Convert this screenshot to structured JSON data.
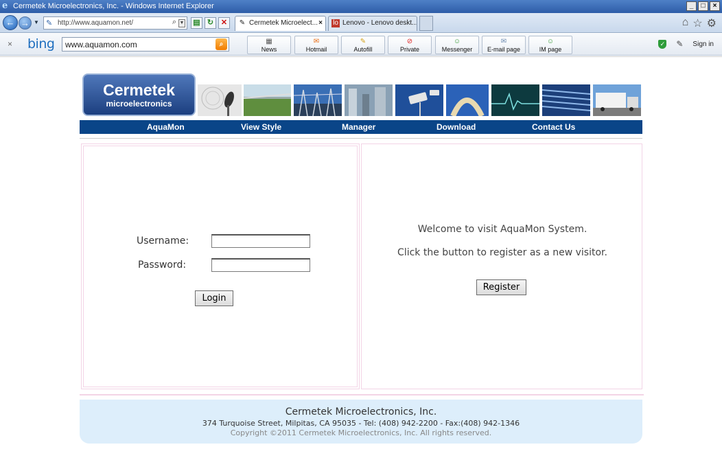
{
  "window": {
    "title": "Cermetek Microelectronics, Inc. - Windows Internet Explorer",
    "controls": [
      "_",
      "□",
      "×"
    ]
  },
  "navbar": {
    "url": "http://www.aquamon.net/",
    "tabs": [
      {
        "label": "Cermetek Microelect...",
        "close": "×"
      },
      {
        "label": "Lenovo - Lenovo deskt..."
      }
    ]
  },
  "bing_toolbar": {
    "close": "×",
    "logo": "bing",
    "search_value": "www.aquamon.com",
    "buttons": [
      {
        "label": "News",
        "icon": "news-icon"
      },
      {
        "label": "Hotmail",
        "icon": "hotmail-icon"
      },
      {
        "label": "Autofill",
        "icon": "pencil-icon"
      },
      {
        "label": "Private",
        "icon": "no-entry-icon"
      },
      {
        "label": "Messenger",
        "icon": "people-icon"
      },
      {
        "label": "E-mail page",
        "icon": "envelope-icon"
      },
      {
        "label": "IM page",
        "icon": "people-icon"
      }
    ],
    "sign_in": "Sign in"
  },
  "site": {
    "logo_line1": "Cermetek",
    "logo_line2": "microelectronics",
    "nav": [
      "AquaMon",
      "View Style",
      "Manager",
      "Download",
      "Contact Us"
    ],
    "login": {
      "username_label": "Username:",
      "password_label": "Password:",
      "username_value": "",
      "password_value": "",
      "login_button": "Login"
    },
    "register": {
      "welcome": "Welcome to visit AquaMon System.",
      "instruction": "Click the button to register as a new visitor.",
      "register_button": "Register"
    },
    "footer": {
      "company": "Cermetek Microelectronics, Inc.",
      "address": "374 Turquoise Street, Milpitas, CA 95035  -  Tel: (408) 942-2200  -  Fax:(408) 942-1346",
      "copyright": "Copyright ©2011 Cermetek Microelectronics, Inc.  All rights reserved."
    }
  },
  "colors": {
    "nav_bar": "#0a4588",
    "logo_blue": "#1c3f80",
    "panel_border": "#f3d4e6",
    "footer_bg": "#ddeefb"
  }
}
